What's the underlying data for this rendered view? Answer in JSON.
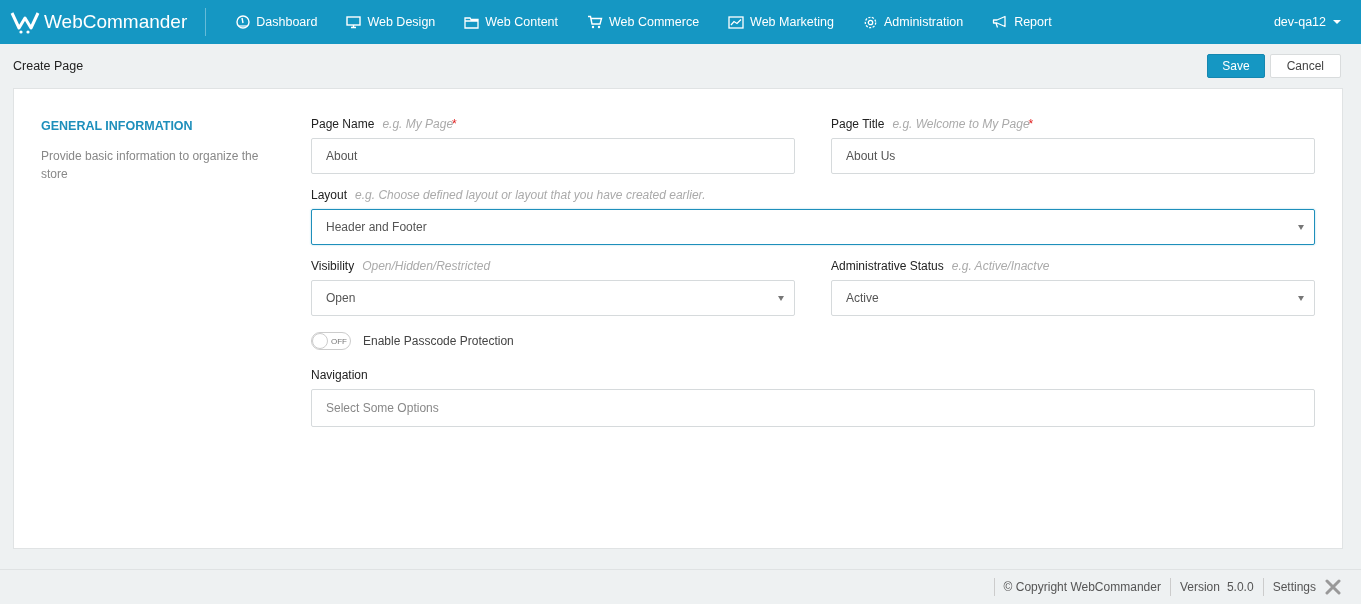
{
  "brand": {
    "name": "WebCommander"
  },
  "nav": [
    {
      "label": "Dashboard"
    },
    {
      "label": "Web Design"
    },
    {
      "label": "Web Content"
    },
    {
      "label": "Web Commerce"
    },
    {
      "label": "Web Marketing"
    },
    {
      "label": "Administration"
    },
    {
      "label": "Report"
    }
  ],
  "user": {
    "name": "dev-qa12"
  },
  "page_title": "Create Page",
  "actions": {
    "save": "Save",
    "cancel": "Cancel"
  },
  "section": {
    "title": "GENERAL INFORMATION",
    "description": "Provide basic information to organize the store"
  },
  "rows": [
    [
      {
        "kind": "text",
        "label": "Page Name",
        "hint": "e.g. My Page",
        "required_mark": "*",
        "value": "About",
        "focused": false
      },
      {
        "kind": "text",
        "label": "Page Title",
        "hint": "e.g. Welcome to My Page",
        "required_mark": "*",
        "value": "About Us",
        "focused": false
      }
    ],
    [
      {
        "kind": "select",
        "label": "Layout",
        "hint": "e.g. Choose defined layout or layout that you have created earlier.",
        "value": "Header and Footer",
        "focused": true
      }
    ],
    [
      {
        "kind": "select",
        "label": "Visibility",
        "hint": "Open/Hidden/Restricted",
        "value": "Open",
        "focused": false
      },
      {
        "kind": "select",
        "label": "Administrative Status",
        "hint": "e.g. Active/Inactve",
        "value": "Active",
        "focused": false
      }
    ],
    [
      {
        "kind": "toggle",
        "label": "Enable Passcode Protection",
        "on": false,
        "state_text": "OFF"
      }
    ],
    [
      {
        "kind": "multiselect",
        "label": "Navigation",
        "placeholder": "Select Some Options",
        "focused": false
      }
    ]
  ],
  "footer": {
    "copyright": "© Copyright WebCommander",
    "version_label": "Version",
    "version": "5.0.0",
    "settings": "Settings"
  }
}
